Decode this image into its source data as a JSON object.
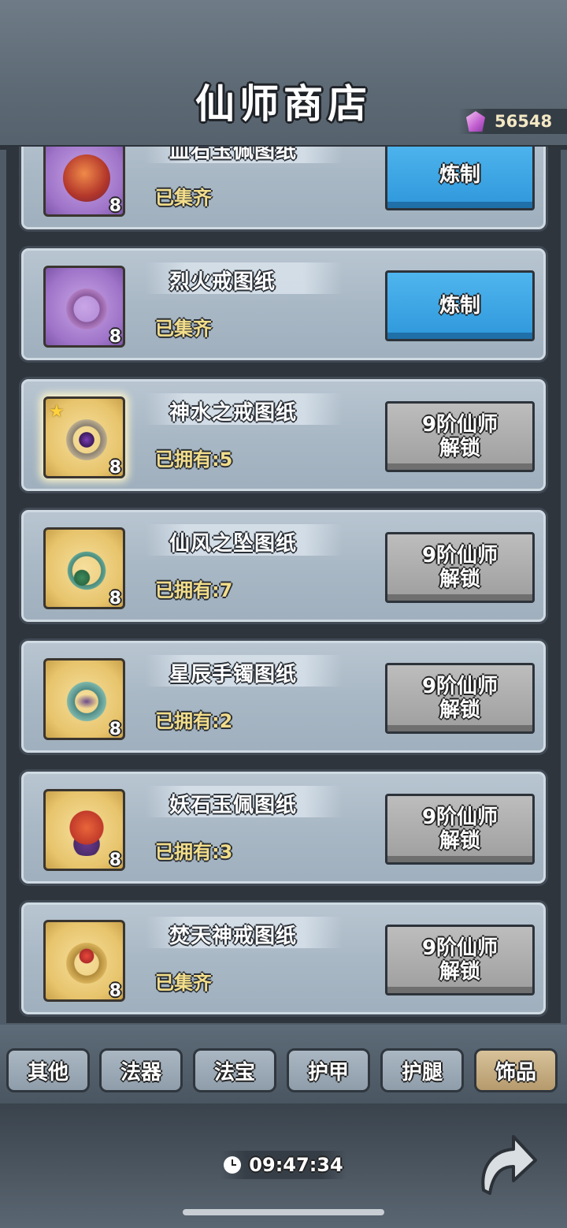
{
  "header": {
    "title": "仙师商店",
    "currency": {
      "icon": "gem-icon",
      "value": "56548"
    }
  },
  "items": [
    {
      "name": "血石玉佩图纸",
      "status": "已集齐",
      "count": "8",
      "icon": "blood-jade-pendant-icon",
      "rarity": "purple",
      "star": false,
      "button": "炼制",
      "button_style": "blue"
    },
    {
      "name": "烈火戒图纸",
      "status": "已集齐",
      "count": "8",
      "icon": "fire-ring-icon",
      "rarity": "purple",
      "star": false,
      "button": "炼制",
      "button_style": "blue"
    },
    {
      "name": "神水之戒图纸",
      "status": "已拥有:5",
      "count": "8",
      "icon": "divine-water-ring-icon",
      "rarity": "gold",
      "star": true,
      "button_line1": "9阶仙师",
      "button_line2": "解锁",
      "button_style": "grey"
    },
    {
      "name": "仙风之坠图纸",
      "status": "已拥有:7",
      "count": "8",
      "icon": "immortal-wind-pendant-icon",
      "rarity": "gold",
      "star": false,
      "button_line1": "9阶仙师",
      "button_line2": "解锁",
      "button_style": "grey"
    },
    {
      "name": "星辰手镯图纸",
      "status": "已拥有:2",
      "count": "8",
      "icon": "star-bracelet-icon",
      "rarity": "gold",
      "star": false,
      "button_line1": "9阶仙师",
      "button_line2": "解锁",
      "button_style": "grey"
    },
    {
      "name": "妖石玉佩图纸",
      "status": "已拥有:3",
      "count": "8",
      "icon": "demon-jade-pendant-icon",
      "rarity": "gold",
      "star": false,
      "button_line1": "9阶仙师",
      "button_line2": "解锁",
      "button_style": "grey"
    },
    {
      "name": "焚天神戒图纸",
      "status": "已集齐",
      "count": "8",
      "icon": "sky-burning-ring-icon",
      "rarity": "gold",
      "star": false,
      "button_line1": "9阶仙师",
      "button_line2": "解锁",
      "button_style": "grey"
    }
  ],
  "tabs": [
    {
      "label": "其他",
      "active": false
    },
    {
      "label": "法器",
      "active": false
    },
    {
      "label": "法宝",
      "active": false
    },
    {
      "label": "护甲",
      "active": false
    },
    {
      "label": "护腿",
      "active": false
    },
    {
      "label": "饰品",
      "active": true
    }
  ],
  "footer": {
    "timer_icon": "clock-icon",
    "timer": "09:47:34",
    "back_icon": "back-arrow-icon"
  }
}
